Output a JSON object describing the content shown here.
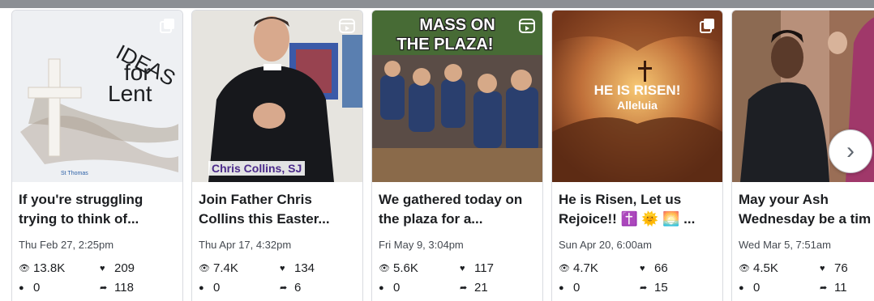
{
  "posts": [
    {
      "thumb_text": [
        "IDEAS",
        "for",
        "Lent"
      ],
      "thumb_small": "St Thomas",
      "caption_line1": "If you're struggling",
      "caption_line2": "trying to think of...",
      "date": "Thu Feb 27, 2:25pm",
      "views": "13.8K",
      "likes": "209",
      "comments": "0",
      "shares": "118",
      "media_type": "carousel-icon"
    },
    {
      "thumb_text": [
        "Chris Collins, SJ"
      ],
      "caption_line1": "Join Father Chris",
      "caption_line2": "Collins this Easter...",
      "date": "Thu Apr 17, 4:32pm",
      "views": "7.4K",
      "likes": "134",
      "comments": "0",
      "shares": "6",
      "media_type": "reel-icon"
    },
    {
      "thumb_text": [
        "MASS ON",
        "THE PLAZA!"
      ],
      "caption_line1": "We gathered today on",
      "caption_line2": "the plaza for a...",
      "date": "Fri May 9, 3:04pm",
      "views": "5.6K",
      "likes": "117",
      "comments": "0",
      "shares": "21",
      "media_type": "reel-icon"
    },
    {
      "thumb_text": [
        "HE IS RISEN!",
        "Alleluia"
      ],
      "caption_line1": "He is Risen, Let us",
      "caption_line2": "Rejoice!! ✝️ 🌞 🌅 ...",
      "date": "Sun Apr 20, 6:00am",
      "views": "4.7K",
      "likes": "66",
      "comments": "0",
      "shares": "15",
      "media_type": "carousel-icon"
    },
    {
      "thumb_text": [],
      "caption_line1": "May your Ash",
      "caption_line2": "Wednesday be a tim",
      "date": "Wed Mar 5, 7:51am",
      "views": "4.5K",
      "likes": "76",
      "comments": "0",
      "shares": "11",
      "media_type": "none"
    }
  ],
  "icons": {
    "views": "eye-icon",
    "likes": "heart-icon",
    "comments": "comment-icon",
    "shares": "share-arrow-icon"
  },
  "next_button_glyph": "›"
}
